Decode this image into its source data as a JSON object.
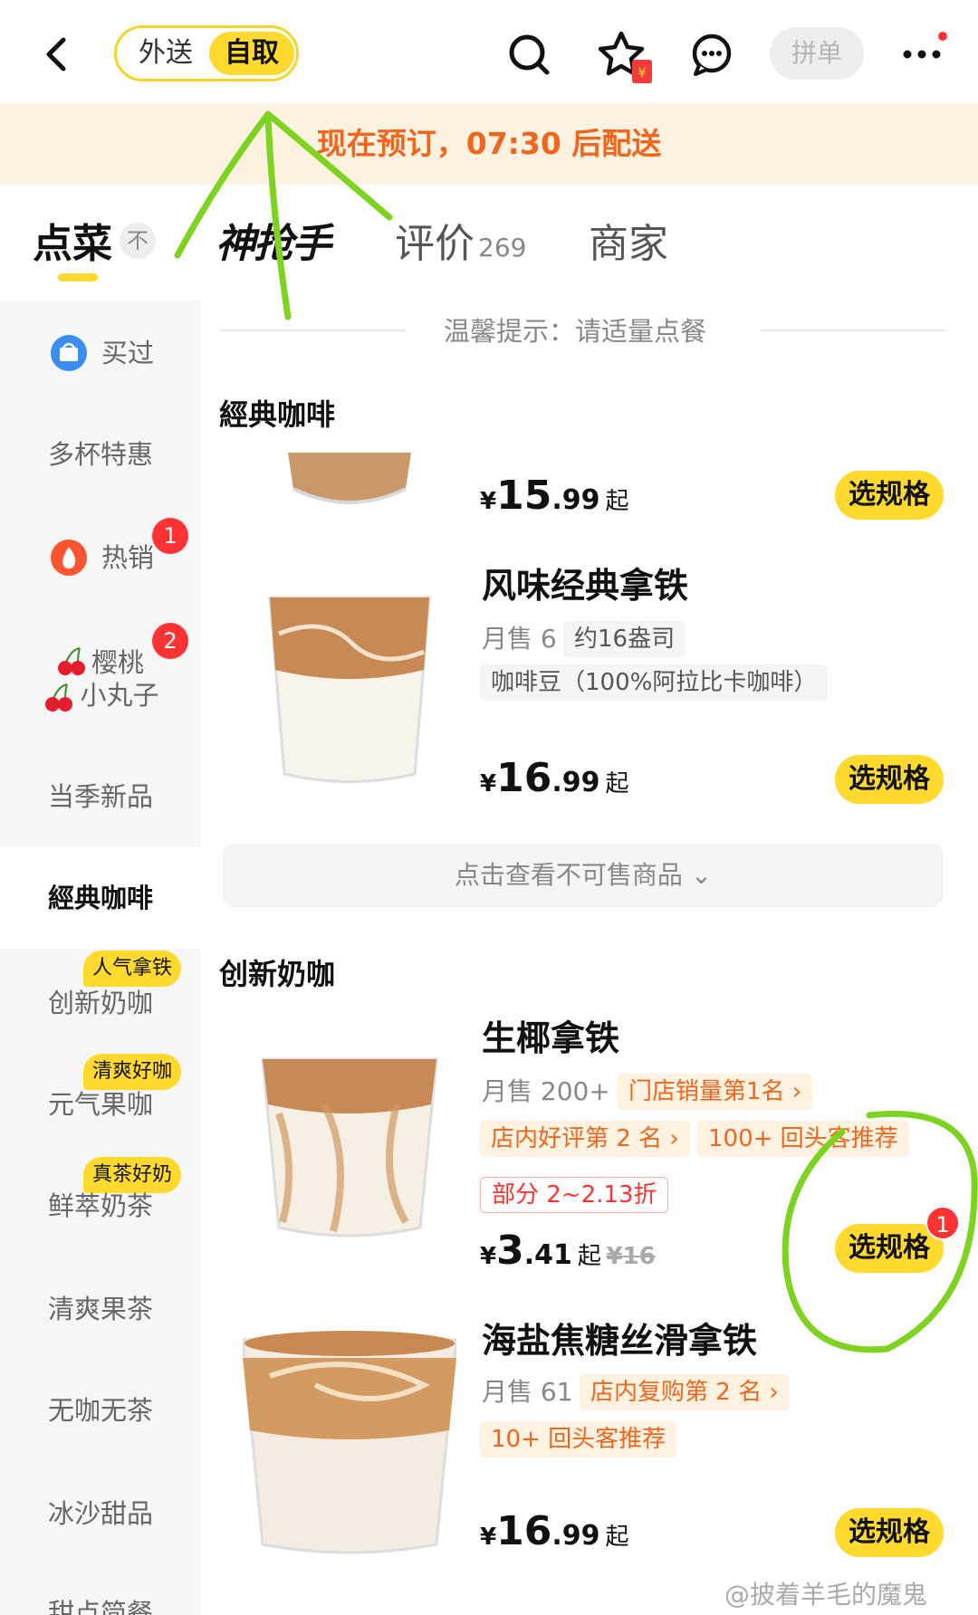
{
  "header": {
    "back_icon": "chevron-left-icon",
    "mode_toggle": {
      "options": [
        "外送",
        "自取"
      ],
      "selected": "自取"
    },
    "icons": [
      "search-icon",
      "star-redpacket-icon",
      "chat-icon",
      "more-icon"
    ],
    "group_order_label": "拼单"
  },
  "notice": {
    "text": "现在预订，07:30 后配送"
  },
  "tabs": {
    "order": "点菜",
    "collapse_icon": "不",
    "grab": "神抢手",
    "review": "评价",
    "review_count": "269",
    "merchant": "商家"
  },
  "tip": {
    "text": "温馨提示：请适量点餐"
  },
  "sidebar": {
    "items": [
      {
        "label": "买过",
        "icon": "basket-icon"
      },
      {
        "label": "多杯特惠"
      },
      {
        "label": "热销",
        "icon": "fire-icon",
        "badge": "1"
      },
      {
        "label": "樱桃",
        "label2": "小丸子",
        "icon": "cherry-icon",
        "badge": "2"
      },
      {
        "label": "当季新品"
      },
      {
        "label": "經典咖啡",
        "active": true
      },
      {
        "label": "创新奶咖",
        "tag": "人气拿铁"
      },
      {
        "label": "元气果咖",
        "tag": "清爽好咖"
      },
      {
        "label": "鲜萃奶茶",
        "tag": "真茶好奶"
      },
      {
        "label": "清爽果茶"
      },
      {
        "label": "无咖无茶"
      },
      {
        "label": "冰沙甜品"
      },
      {
        "label": "甜点简餐"
      }
    ]
  },
  "sections": {
    "classic": "經典咖啡",
    "creative": "创新奶咖"
  },
  "products": [
    {
      "price_cur": "¥",
      "price_int": "15",
      "price_dec": ".99",
      "price_suffix": "起",
      "button": "选规格"
    },
    {
      "name": "风味经典拿铁",
      "sold": "月售 6",
      "chips": [
        "约16盎司",
        "咖啡豆（100%阿拉比卡咖啡）"
      ],
      "price_cur": "¥",
      "price_int": "16",
      "price_dec": ".99",
      "price_suffix": "起",
      "button": "选规格"
    },
    {
      "name": "生椰拿铁",
      "sold": "月售 200+",
      "rank_chip": "门店销量第1名 ›",
      "chips": [
        "店内好评第 2 名 ›",
        "100+ 回头客推荐"
      ],
      "discount": "部分 2~2.13折",
      "price_cur": "¥",
      "price_int": "3",
      "price_dec": ".41",
      "price_suffix": "起",
      "orig_price": "¥16",
      "button": "选规格",
      "button_badge": "1"
    },
    {
      "name": "海盐焦糖丝滑拿铁",
      "sold": "月售 61",
      "rank_chip": "店内复购第 2 名 ›",
      "chips": [
        "10+ 回头客推荐"
      ],
      "price_cur": "¥",
      "price_int": "16",
      "price_dec": ".99",
      "price_suffix": "起",
      "button": "选规格"
    }
  ],
  "unavailable": {
    "label": "点击查看不可售商品 ⌄"
  },
  "watermark": {
    "text": "@披着羊毛的魔鬼"
  },
  "colors": {
    "accent_yellow": "#ffd92d",
    "notice_bg": "#fdf1df",
    "notice_text": "#f0661f",
    "badge_red": "#ff3333",
    "annotation_green": "#7ed321"
  }
}
